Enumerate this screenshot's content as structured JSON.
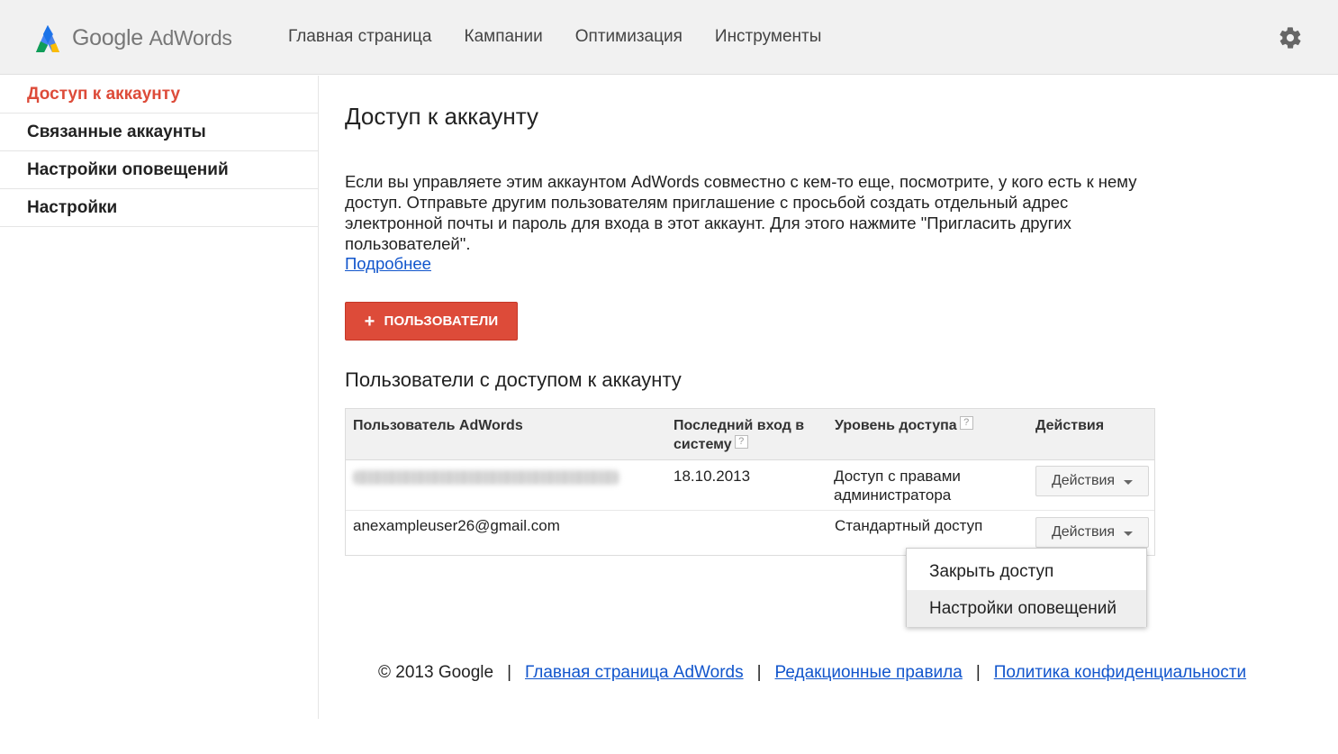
{
  "header": {
    "logo_google": "Google",
    "logo_product": "AdWords",
    "nav": [
      "Главная страница",
      "Кампании",
      "Оптимизация",
      "Инструменты"
    ],
    "settings_icon": "gear-icon",
    "brand_colors": {
      "blue": "#4285f4",
      "green": "#34a853",
      "yellow": "#fbbc05"
    }
  },
  "sidebar": {
    "items": [
      {
        "label": "Доступ к аккаунту",
        "active": true
      },
      {
        "label": "Связанные аккаунты",
        "active": false
      },
      {
        "label": "Настройки оповещений",
        "active": false
      },
      {
        "label": "Настройки",
        "active": false
      }
    ],
    "active_color": "#dd4b39"
  },
  "main": {
    "title": "Доступ к аккаунту",
    "description": "Если вы управляете этим аккаунтом AdWords совместно с кем-то еще, посмотрите, у кого есть к нему доступ. Отправьте другим пользователям приглашение с просьбой создать отдельный адрес электронной почты и пароль для входа в этот аккаунт. Для этого нажмите \"Пригласить других пользователей\".",
    "more_link": "Подробнее",
    "add_button": {
      "icon": "+",
      "label": "ПОЛЬЗОВАТЕЛИ",
      "color": "#dd4b39"
    },
    "section_title": "Пользователи с доступом к аккаунту",
    "table": {
      "headers": {
        "user": "Пользователь AdWords",
        "last_login": "Последний вход в систему",
        "access_level": "Уровень доступа",
        "actions": "Действия"
      },
      "help_glyph": "?",
      "rows": [
        {
          "user": "",
          "user_blurred": true,
          "last_login": "18.10.2013",
          "access_level": "Доступ с правами администратора",
          "actions_label": "Действия"
        },
        {
          "user": "anexampleuser26@gmail.com",
          "user_blurred": false,
          "last_login": "",
          "access_level": "Стандартный доступ",
          "actions_label": "Действия"
        }
      ]
    },
    "dropdown_menu": {
      "items": [
        "Закрыть доступ",
        "Настройки оповещений"
      ],
      "hovered_index": 1
    }
  },
  "footer": {
    "copyright": "© 2013 Google",
    "separator": "|",
    "links": [
      "Главная страница AdWords",
      "Редакционные правила",
      "Политика конфиденциальности"
    ],
    "link_color": "#1155cc"
  }
}
